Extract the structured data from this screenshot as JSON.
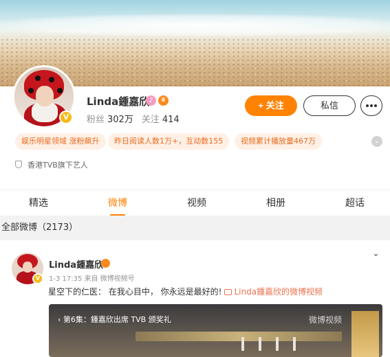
{
  "profile": {
    "name": "Linda鍾嘉欣",
    "verified_mark": "V",
    "followers_label": "粉丝",
    "followers": "302万",
    "following_label": "关注",
    "following": "414",
    "follow_button": "+ 关注",
    "message_button": "私信",
    "tags": [
      "娱乐明星领域 涨粉飙升",
      "昨日阅读人数1万+，互动数155",
      "视频累计播放量467万"
    ],
    "description": "香港TVB旗下艺人"
  },
  "tabs": [
    {
      "label": "精选",
      "active": false
    },
    {
      "label": "微博",
      "active": true
    },
    {
      "label": "视频",
      "active": false
    },
    {
      "label": "相册",
      "active": false
    },
    {
      "label": "超话",
      "active": false
    }
  ],
  "section": {
    "label": "全部微博（2173）"
  },
  "post": {
    "author": "Linda鍾嘉欣",
    "meta": "1-3 17:35 来自 微博视频号",
    "text": "星空下的仁医： 在我心目中， 你永远是最好的!",
    "link": "Linda鍾嘉欣的微博视频",
    "video_title": "第6集：鍾嘉欣出席 TVB 颁奖礼",
    "video_watermark": "微博视频"
  },
  "colors": {
    "accent": "#ff8200",
    "tag_bg": "#fff0e6",
    "tag_text": "#e86b1a",
    "link": "#eb7350"
  }
}
